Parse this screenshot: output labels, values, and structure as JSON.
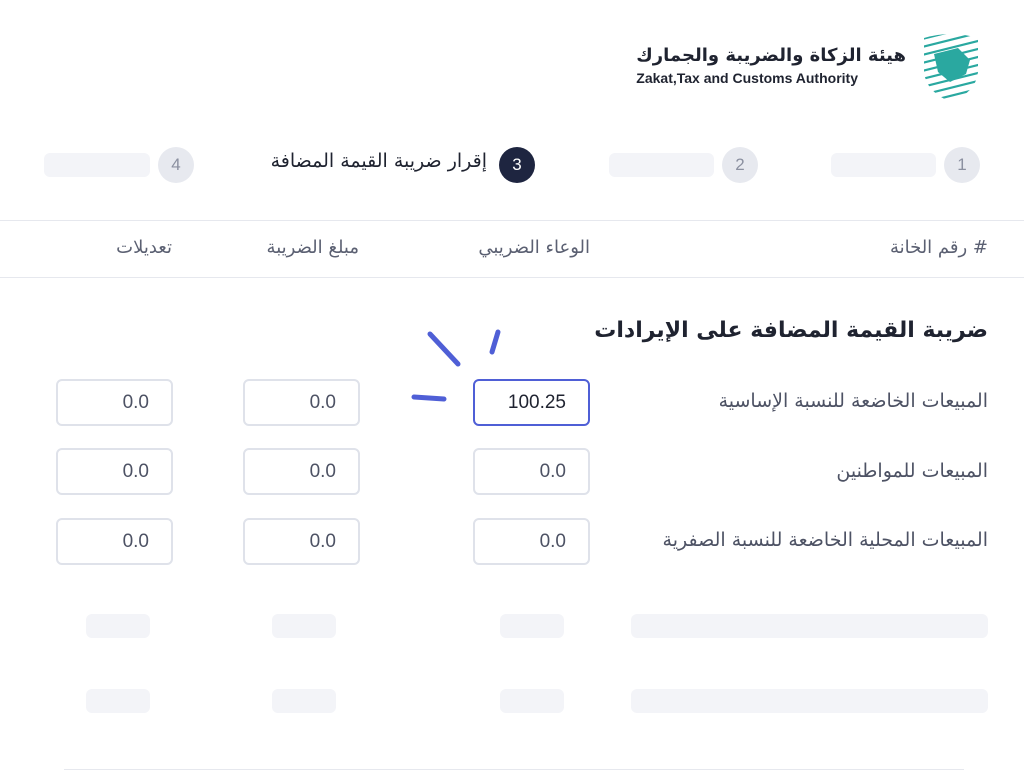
{
  "header": {
    "org_name_ar": "هيئة الزكاة والضريبة والجمارك",
    "org_name_en": "Zakat,Tax and Customs Authority",
    "logo_icon": "zatca-logo-icon",
    "brand_color": "#2aa8a0"
  },
  "stepper": {
    "steps": [
      {
        "number": "1",
        "label": ""
      },
      {
        "number": "2",
        "label": ""
      },
      {
        "number": "3",
        "label": "إقرار ضريبة القيمة المضافة",
        "active": true
      },
      {
        "number": "4",
        "label": ""
      }
    ],
    "active_color": "#1e2540"
  },
  "table": {
    "headers": {
      "box_number": "# رقم الخانة",
      "tax_base": "الوعاء الضريبي",
      "tax_amount": "مبلغ الضريبة",
      "adjustments": "تعديلات"
    }
  },
  "section": {
    "title": "ضريبة القيمة المضافة على الإيرادات",
    "rows": [
      {
        "label": "المبيعات الخاضعة للنسبة الإساسية",
        "tax_base": "100.25",
        "tax_amount": "0.0",
        "adjustments": "0.0"
      },
      {
        "label": "المبيعات للمواطنين",
        "tax_base": "0.0",
        "tax_amount": "0.0",
        "adjustments": "0.0"
      },
      {
        "label": "المبيعات المحلية الخاضعة للنسبة الصفرية",
        "tax_base": "0.0",
        "tax_amount": "0.0",
        "adjustments": "0.0"
      }
    ]
  },
  "focus_color": "#4f5fd6"
}
